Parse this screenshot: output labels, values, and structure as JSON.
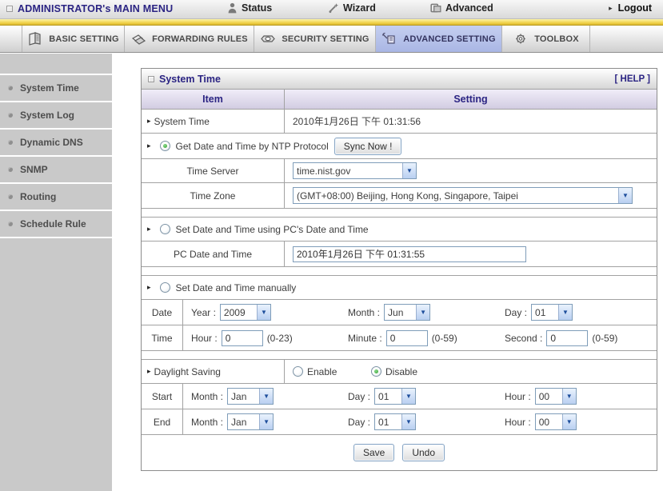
{
  "topbar": {
    "title": "ADMINISTRATOR's MAIN MENU",
    "status": "Status",
    "wizard": "Wizard",
    "advanced": "Advanced",
    "logout": "Logout",
    "logout_arrow": "▸"
  },
  "tabs": [
    {
      "label": "BASIC SETTING",
      "active": false
    },
    {
      "label": "FORWARDING RULES",
      "active": false
    },
    {
      "label": "SECURITY SETTING",
      "active": false
    },
    {
      "label": "ADVANCED SETTING",
      "active": true
    },
    {
      "label": "TOOLBOX",
      "active": false
    }
  ],
  "sidebar": {
    "items": [
      {
        "label": "System Time"
      },
      {
        "label": "System Log"
      },
      {
        "label": "Dynamic DNS"
      },
      {
        "label": "SNMP"
      },
      {
        "label": "Routing"
      },
      {
        "label": "Schedule Rule"
      }
    ]
  },
  "panel": {
    "title": "System Time",
    "help_label": "[ HELP ]",
    "marker": "▸",
    "chevron": "▼",
    "header": {
      "item": "Item",
      "setting": "Setting"
    },
    "rows": {
      "system_time": {
        "label": "System Time",
        "value": "2010年1月26日 下午 01:31:56"
      },
      "ntp": {
        "label": "Get Date and Time by NTP Protocol",
        "selected": true,
        "sync_button": "Sync Now !",
        "time_server": {
          "label": "Time Server",
          "value": "time.nist.gov"
        },
        "time_zone": {
          "label": "Time Zone",
          "value": "(GMT+08:00) Beijing, Hong Kong, Singapore, Taipei"
        }
      },
      "pc_time": {
        "label": "Set Date and Time using PC's Date and Time",
        "selected": false,
        "field": {
          "label": "PC Date and Time",
          "value": "2010年1月26日 下午 01:31:55"
        }
      },
      "manual": {
        "label": "Set Date and Time manually",
        "selected": false,
        "date": {
          "label": "Date",
          "year_label": "Year :",
          "year": "2009",
          "month_label": "Month :",
          "month": "Jun",
          "day_label": "Day :",
          "day": "01"
        },
        "time": {
          "label": "Time",
          "hour_label": "Hour :",
          "hour": "0",
          "hour_range": "(0-23)",
          "minute_label": "Minute :",
          "minute": "0",
          "minute_range": "(0-59)",
          "second_label": "Second :",
          "second": "0",
          "second_range": "(0-59)"
        }
      },
      "daylight": {
        "label": "Daylight Saving",
        "enable_label": "Enable",
        "disable_label": "Disable",
        "selected": "disable",
        "month_label": "Month :",
        "day_label": "Day :",
        "hour_label": "Hour :",
        "start": {
          "label": "Start",
          "month": "Jan",
          "day": "01",
          "hour": "00"
        },
        "end": {
          "label": "End",
          "month": "Jan",
          "day": "01",
          "hour": "00"
        }
      }
    },
    "buttons": {
      "save": "Save",
      "undo": "Undo"
    }
  },
  "colors": {
    "active_tab": "#aeb9e6",
    "title_navy": "#2b2483",
    "stripe_yellow": "#efcf44",
    "radio_on_green": "#2f9e2f"
  }
}
